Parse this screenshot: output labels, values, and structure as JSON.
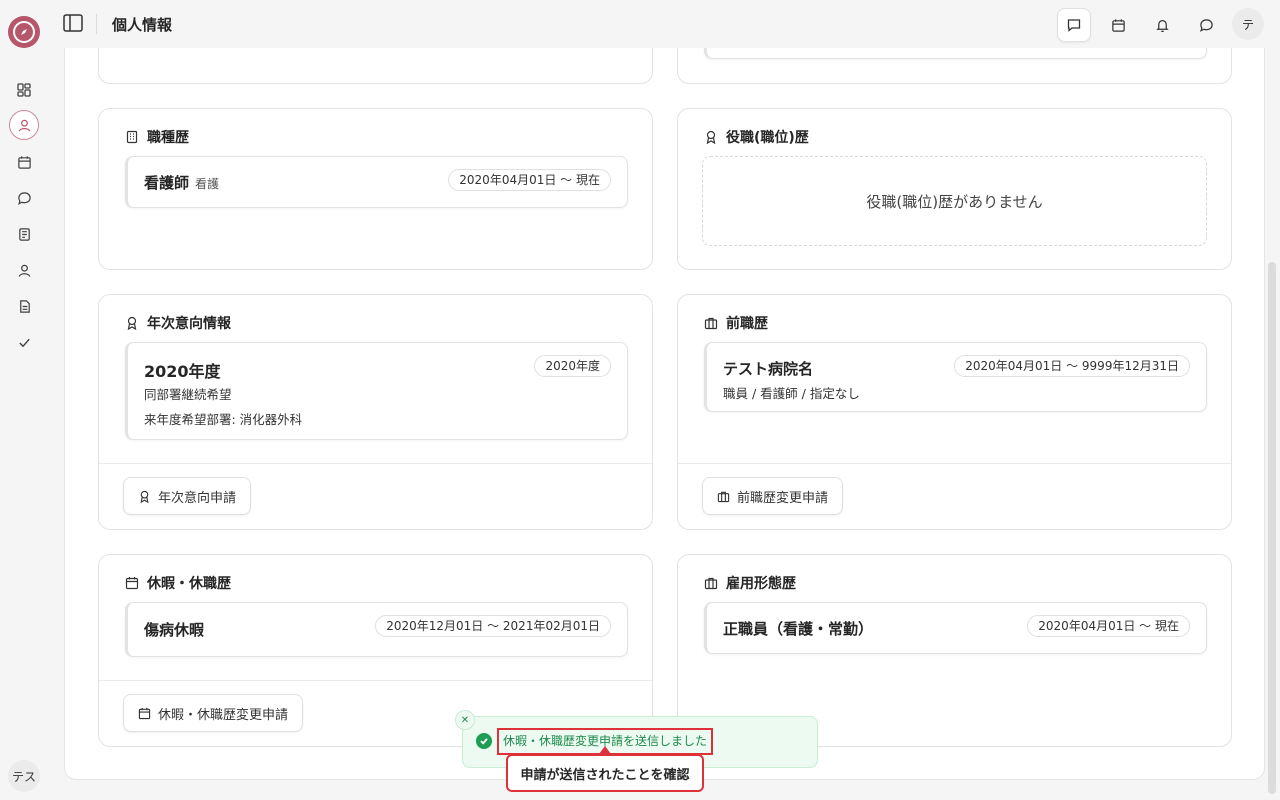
{
  "header": {
    "title": "個人情報",
    "avatar": "テ"
  },
  "sidebar": {
    "avatar": "テス"
  },
  "cards": {
    "job_type": {
      "title": "職種歴",
      "entry": {
        "name": "看護師",
        "sub": "看護",
        "date": "2020年04月01日 〜 現在"
      }
    },
    "position": {
      "title": "役職(職位)歴",
      "empty": "役職(職位)歴がありません"
    },
    "annual_intent": {
      "title": "年次意向情報",
      "entry": {
        "name": "2020年度",
        "badge": "2020年度",
        "line1": "同部署継続希望",
        "line2": "来年度希望部署: 消化器外科"
      },
      "button": "年次意向申請"
    },
    "previous_job": {
      "title": "前職歴",
      "entry": {
        "name": "テスト病院名",
        "date": "2020年04月01日 〜 9999年12月31日",
        "line1": "職員 / 看護師 / 指定なし"
      },
      "button": "前職歴変更申請"
    },
    "leave": {
      "title": "休暇・休職歴",
      "entry": {
        "name": "傷病休暇",
        "date": "2020年12月01日 〜 2021年02月01日"
      },
      "button": "休暇・休職歴変更申請"
    },
    "employment": {
      "title": "雇用形態歴",
      "entry": {
        "name": "正職員（看護・常勤）",
        "date": "2020年04月01日 〜 現在"
      }
    }
  },
  "toast": {
    "message": "休暇・休職歴変更申請を送信しました",
    "callout": "申請が送信されたことを確認"
  },
  "colors": {
    "brand": "#b5566a",
    "success": "#1f9d55",
    "highlight": "#e0303a"
  }
}
